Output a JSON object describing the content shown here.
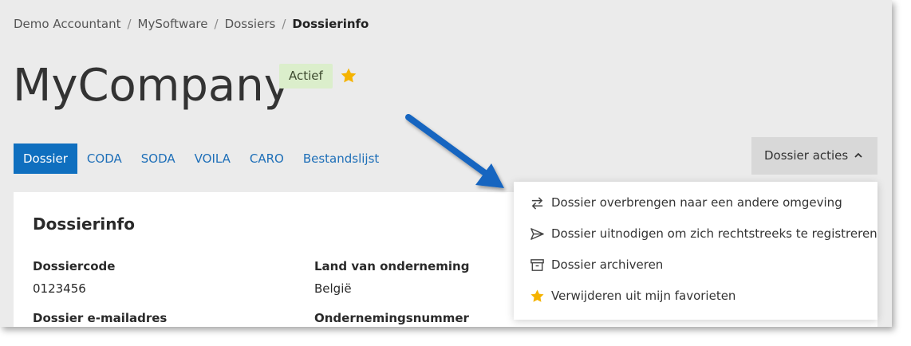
{
  "breadcrumb": {
    "items": [
      "Demo Accountant",
      "MySoftware",
      "Dossiers"
    ],
    "current": "Dossierinfo",
    "separator": "/"
  },
  "header": {
    "title": "MyCompany",
    "status_badge": "Actief",
    "favorite_icon": "star-icon"
  },
  "tabs": [
    {
      "label": "Dossier",
      "active": true
    },
    {
      "label": "CODA",
      "active": false
    },
    {
      "label": "SODA",
      "active": false
    },
    {
      "label": "VOILA",
      "active": false
    },
    {
      "label": "CARO",
      "active": false
    },
    {
      "label": "Bestandslijst",
      "active": false
    }
  ],
  "actions": {
    "label": "Dossier acties",
    "expanded": true,
    "menu": [
      {
        "icon": "swap-arrows-icon",
        "label": "Dossier overbrengen naar een andere omgeving"
      },
      {
        "icon": "send-icon",
        "label": "Dossier uitnodigen om zich rechtstreeks te registreren"
      },
      {
        "icon": "archive-icon",
        "label": "Dossier archiveren"
      },
      {
        "icon": "star-icon",
        "label": "Verwijderen uit mijn favorieten"
      }
    ]
  },
  "card": {
    "title": "Dossierinfo",
    "fields": [
      {
        "label": "Dossiercode",
        "value": "0123456"
      },
      {
        "label": "Land van onderneming",
        "value": "België"
      },
      {
        "label": "Dossier e-mailadres",
        "value": ""
      },
      {
        "label": "Ondernemingsnummer",
        "value": ""
      }
    ]
  },
  "colors": {
    "accent": "#0f6fbf",
    "badge_bg": "#dbeecb",
    "star": "#f5b301",
    "arrow": "#1565c0"
  }
}
